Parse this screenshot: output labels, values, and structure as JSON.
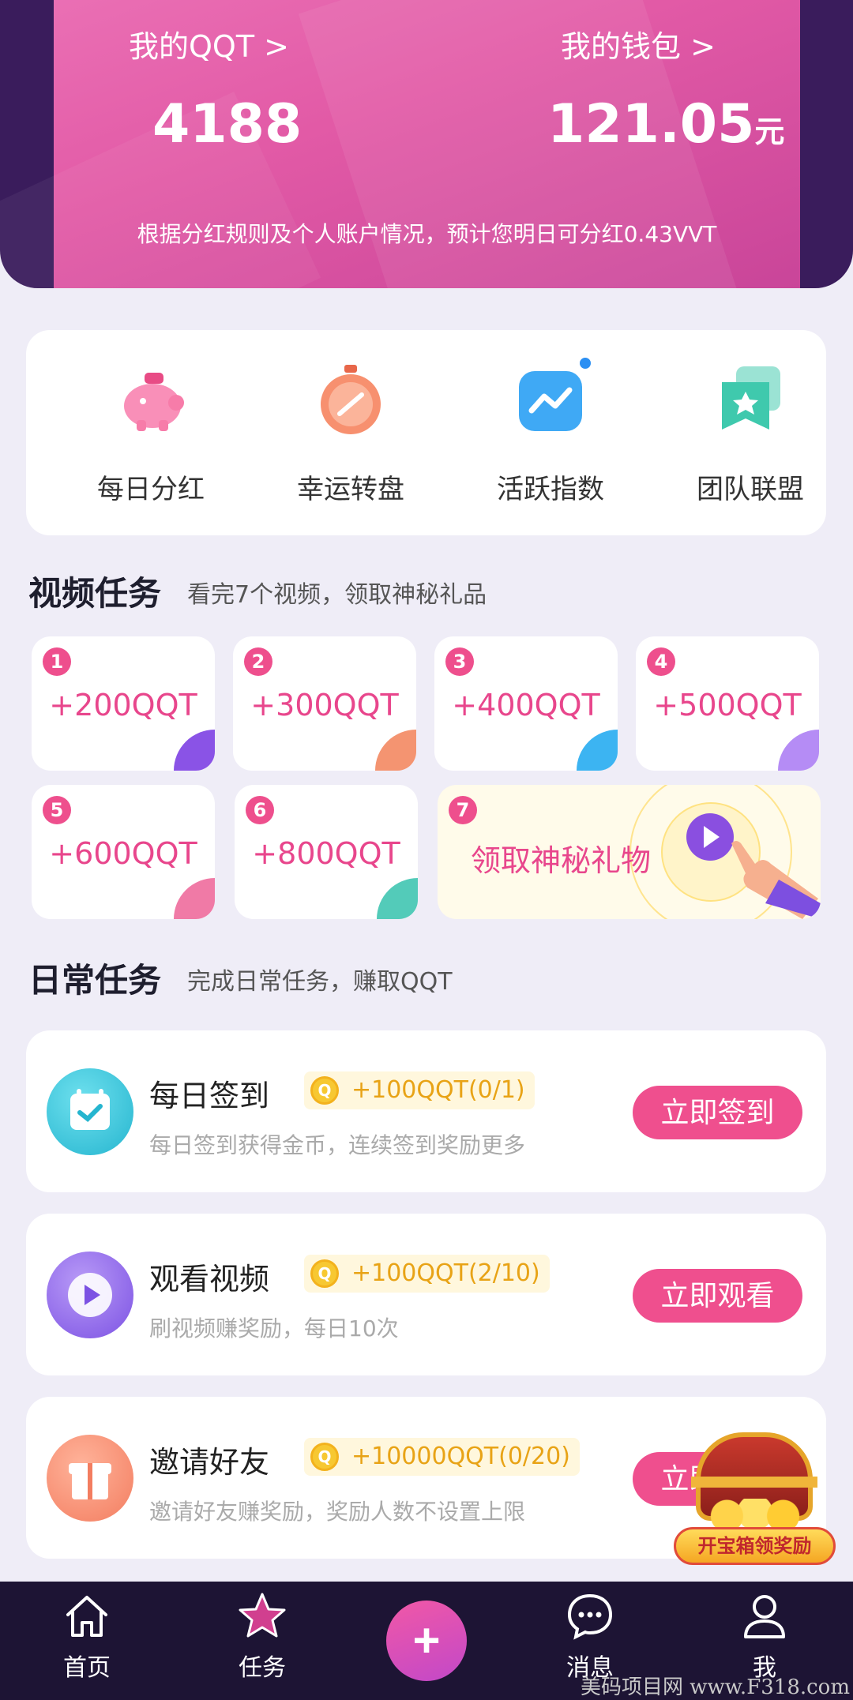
{
  "header": {
    "qqt_link": "我的QQT >",
    "wallet_link": "我的钱包 >",
    "qqt_value": "4188",
    "wallet_value": "121.05",
    "wallet_unit": "元",
    "note": "根据分红规则及个人账户情况，预计您明日可分红0.43VVT"
  },
  "quick_entries": [
    {
      "label": "每日分红",
      "icon": "piggy-bank-icon"
    },
    {
      "label": "幸运转盘",
      "icon": "lucky-wheel-icon"
    },
    {
      "label": "活跃指数",
      "icon": "activity-chart-icon"
    },
    {
      "label": "团队联盟",
      "icon": "team-star-icon"
    }
  ],
  "video_section": {
    "title": "视频任务",
    "subtitle": "看完7个视频，领取神秘礼品",
    "tasks": [
      {
        "num": "1",
        "reward": "+200QQT",
        "accent": "#8a53e6"
      },
      {
        "num": "2",
        "reward": "+300QQT",
        "accent": "#f49471"
      },
      {
        "num": "3",
        "reward": "+400QQT",
        "accent": "#3cb4f2"
      },
      {
        "num": "4",
        "reward": "+500QQT",
        "accent": "#b58cf5"
      },
      {
        "num": "5",
        "reward": "+600QQT",
        "accent": "#f07aa6"
      },
      {
        "num": "6",
        "reward": "+800QQT",
        "accent": "#53cbb9"
      }
    ],
    "gift": {
      "num": "7",
      "label": "领取神秘礼物"
    }
  },
  "daily_section": {
    "title": "日常任务",
    "subtitle": "完成日常任务，赚取QQT",
    "tasks": [
      {
        "title": "每日签到",
        "reward": "+100QQT(0/1)",
        "desc": "每日签到获得金币，连续签到奖励更多",
        "button": "立即签到",
        "icon": "calendar-check-icon",
        "color": "#2fc2d8"
      },
      {
        "title": "观看视频",
        "reward": "+100QQT(2/10)",
        "desc": "刷视频赚奖励，每日10次",
        "button": "立即观看",
        "icon": "play-icon",
        "color": "#8f64ea"
      },
      {
        "title": "邀请好友",
        "reward": "+10000QQT(0/20)",
        "desc": "邀请好友赚奖励，奖励人数不设置上限",
        "button": "立即邀请",
        "icon": "gift-icon",
        "color": "#f68e6c"
      }
    ],
    "coin_glyph": "Q"
  },
  "chest": {
    "label": "开宝箱领奖励"
  },
  "nav": {
    "home": "首页",
    "tasks": "任务",
    "plus": "+",
    "messages": "消息",
    "me": "我"
  },
  "watermark": "美码项目网 www.F318.com",
  "colors": {
    "accent": "#ef4f8e",
    "nav_bg": "#1d1434",
    "page_bg": "#efedf7"
  }
}
